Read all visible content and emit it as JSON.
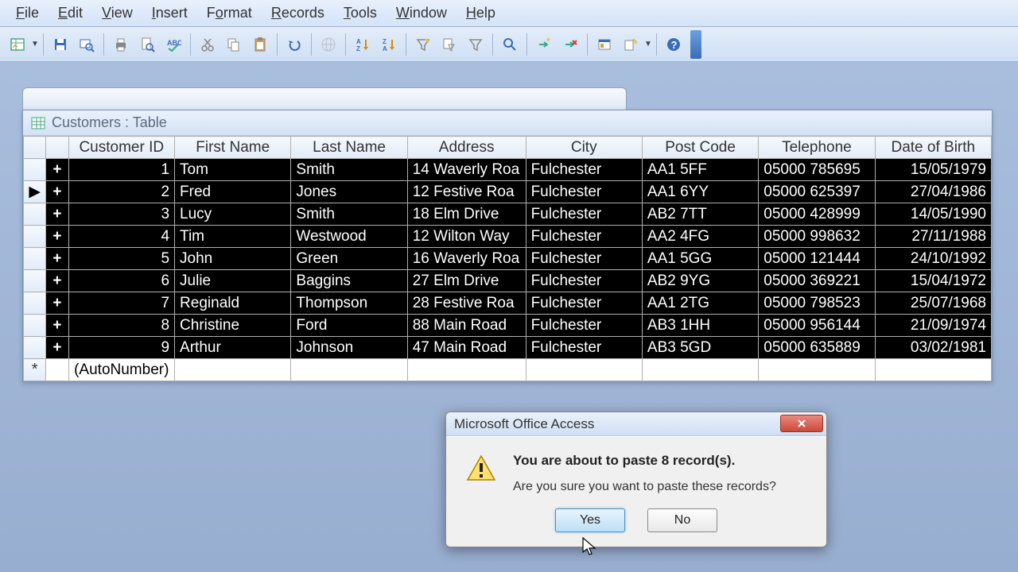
{
  "menu": {
    "items": [
      {
        "label": "File",
        "u": "F"
      },
      {
        "label": "Edit",
        "u": "E"
      },
      {
        "label": "View",
        "u": "V"
      },
      {
        "label": "Insert",
        "u": "I"
      },
      {
        "label": "Format",
        "u": "o"
      },
      {
        "label": "Records",
        "u": "R"
      },
      {
        "label": "Tools",
        "u": "T"
      },
      {
        "label": "Window",
        "u": "W"
      },
      {
        "label": "Help",
        "u": "H"
      }
    ]
  },
  "window": {
    "title": "Customers : Table"
  },
  "table": {
    "headers": [
      "Customer ID",
      "First Name",
      "Last Name",
      "Address",
      "City",
      "Post Code",
      "Telephone",
      "Date of Birth"
    ],
    "rows": [
      {
        "id": "1",
        "fn": "Tom",
        "ln": "Smith",
        "addr": "14 Waverly Roa",
        "city": "Fulchester",
        "post": "AA1 5FF",
        "tel": "05000 785695",
        "dob": "15/05/1979",
        "selected": true,
        "current": false
      },
      {
        "id": "2",
        "fn": "Fred",
        "ln": "Jones",
        "addr": "12 Festive Roa",
        "city": "Fulchester",
        "post": "AA1 6YY",
        "tel": "05000 625397",
        "dob": "27/04/1986",
        "selected": true,
        "current": true
      },
      {
        "id": "3",
        "fn": "Lucy",
        "ln": "Smith",
        "addr": "18 Elm Drive",
        "city": "Fulchester",
        "post": "AB2 7TT",
        "tel": "05000 428999",
        "dob": "14/05/1990",
        "selected": true,
        "current": false
      },
      {
        "id": "4",
        "fn": "Tim",
        "ln": "Westwood",
        "addr": "12 Wilton Way",
        "city": "Fulchester",
        "post": "AA2 4FG",
        "tel": "05000 998632",
        "dob": "27/11/1988",
        "selected": true,
        "current": false
      },
      {
        "id": "5",
        "fn": "John",
        "ln": "Green",
        "addr": "16 Waverly Roa",
        "city": "Fulchester",
        "post": "AA1 5GG",
        "tel": "05000 121444",
        "dob": "24/10/1992",
        "selected": true,
        "current": false
      },
      {
        "id": "6",
        "fn": "Julie",
        "ln": "Baggins",
        "addr": "27 Elm Drive",
        "city": "Fulchester",
        "post": "AB2 9YG",
        "tel": "05000 369221",
        "dob": "15/04/1972",
        "selected": true,
        "current": false
      },
      {
        "id": "7",
        "fn": "Reginald",
        "ln": "Thompson",
        "addr": "28 Festive Roa",
        "city": "Fulchester",
        "post": "AA1 2TG",
        "tel": "05000 798523",
        "dob": "25/07/1968",
        "selected": true,
        "current": false
      },
      {
        "id": "8",
        "fn": "Christine",
        "ln": "Ford",
        "addr": "88 Main Road",
        "city": "Fulchester",
        "post": "AB3 1HH",
        "tel": "05000 956144",
        "dob": "21/09/1974",
        "selected": true,
        "current": false
      },
      {
        "id": "9",
        "fn": "Arthur",
        "ln": "Johnson",
        "addr": "47 Main Road",
        "city": "Fulchester",
        "post": "AB3 5GD",
        "tel": "05000 635889",
        "dob": "03/02/1981",
        "selected": true,
        "current": false
      }
    ],
    "newrow_placeholder": "(AutoNumber)"
  },
  "dialog": {
    "title": "Microsoft Office Access",
    "heading": "You are about to paste 8 record(s).",
    "message": "Are you sure you want to paste these records?",
    "yes": "Yes",
    "no": "No"
  }
}
